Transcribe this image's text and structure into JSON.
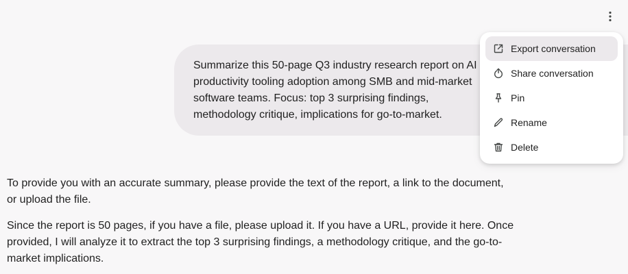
{
  "header": {
    "more_icon": "more-vert-icon"
  },
  "conversation": {
    "user_message": "Summarize this 50-page Q3 industry research report on AI\nproductivity tooling adoption among SMB and mid-market\nsoftware teams. Focus: top 3 surprising findings,\nmethodology critique, implications for go-to-market.",
    "response_paragraphs": [
      "To provide you with an accurate summary, please provide the text of the report, a link to the document, or upload the file.",
      "Since the report is 50 pages, if you have a file, please upload it. If you have a URL, provide it here. Once provided, I will analyze it to extract the top 3 surprising findings, a methodology critique, and the go-to-market implications."
    ]
  },
  "menu": {
    "items": [
      {
        "label": "Export conversation",
        "icon": "external-link-icon",
        "highlighted": true
      },
      {
        "label": "Share conversation",
        "icon": "share-icon",
        "highlighted": false
      },
      {
        "label": "Pin",
        "icon": "pin-icon",
        "highlighted": false
      },
      {
        "label": "Rename",
        "icon": "pencil-icon",
        "highlighted": false
      },
      {
        "label": "Delete",
        "icon": "trash-icon",
        "highlighted": false
      }
    ]
  },
  "colors": {
    "background": "#f8f7f8",
    "bubble": "#ece9ec",
    "menu_background": "#ffffff",
    "text": "#1f1f1f"
  }
}
